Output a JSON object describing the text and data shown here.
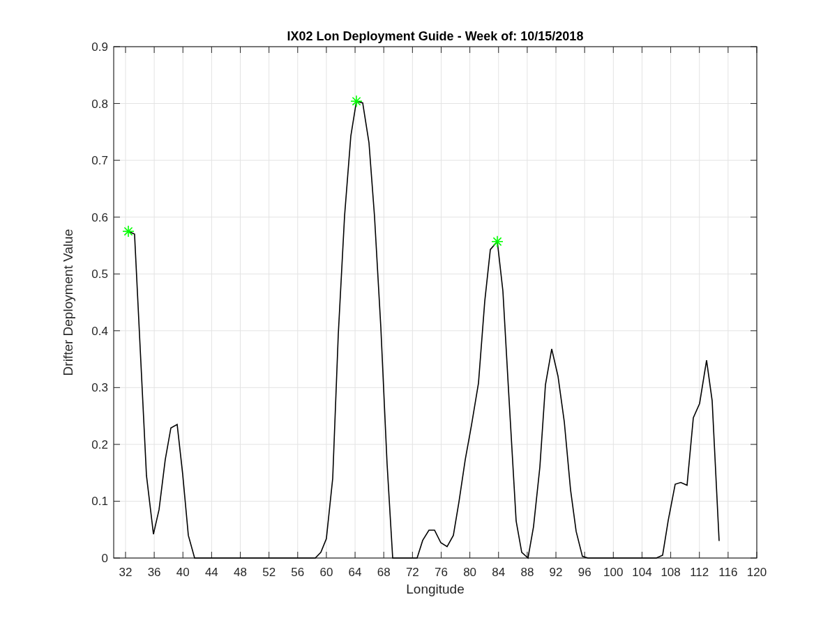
{
  "figure": {
    "chart_data": {
      "type": "line",
      "title": "IX02 Lon Deployment Guide - Week of: 10/15/2018",
      "xlabel": "Longitude",
      "ylabel": "Drifter Deployment Value",
      "x": [
        32.39,
        33.26,
        34.92,
        35.89,
        36.67,
        37.54,
        38.32,
        39.2,
        39.97,
        40.75,
        41.63,
        58.45,
        59.23,
        60.0,
        60.88,
        61.66,
        62.53,
        63.41,
        64.19,
        65.06,
        65.94,
        66.71,
        67.59,
        68.46,
        69.24,
        72.65,
        73.42,
        74.3,
        75.08,
        75.95,
        76.83,
        77.7,
        78.48,
        79.36,
        80.23,
        81.2,
        82.08,
        82.86,
        83.83,
        84.61,
        85.39,
        86.45,
        87.23,
        88.11,
        88.88,
        89.76,
        90.54,
        91.41,
        92.29,
        93.16,
        94.04,
        94.82,
        95.69,
        96.47,
        106.0,
        106.87,
        107.65,
        108.62,
        109.4,
        110.28,
        111.15,
        112.03,
        113.0,
        113.78,
        114.75
      ],
      "series": [
        {
          "color": "#000000",
          "marker": "none",
          "values": [
            0.575,
            0.57,
            0.145,
            0.042,
            0.085,
            0.173,
            0.229,
            0.235,
            0.148,
            0.04,
            0,
            0,
            0.01,
            0.034,
            0.14,
            0.394,
            0.602,
            0.743,
            0.804,
            0.801,
            0.731,
            0.602,
            0.406,
            0.167,
            0,
            0,
            0.031,
            0.049,
            0.049,
            0.027,
            0.02,
            0.04,
            0.099,
            0.173,
            0.234,
            0.308,
            0.452,
            0.543,
            0.557,
            0.47,
            0.295,
            0.065,
            0.01,
            0,
            0.055,
            0.16,
            0.305,
            0.368,
            0.32,
            0.24,
            0.12,
            0.047,
            0.003,
            0,
            0,
            0.005,
            0.066,
            0.13,
            0.133,
            0.128,
            0.247,
            0.272,
            0.348,
            0.277,
            0.03
          ]
        },
        {
          "color": "#00ff00",
          "marker": "cross",
          "values": [
            0.575,
            null,
            null,
            null,
            null,
            null,
            null,
            null,
            null,
            null,
            null,
            null,
            null,
            null,
            null,
            null,
            null,
            null,
            0.804,
            null,
            null,
            null,
            null,
            null,
            null,
            null,
            null,
            null,
            null,
            null,
            null,
            null,
            null,
            null,
            null,
            null,
            null,
            null,
            0.557,
            null,
            null,
            null,
            null,
            null,
            null,
            null,
            null,
            null,
            null,
            null,
            null,
            null,
            null,
            null,
            null,
            null,
            null,
            null,
            null,
            null,
            null,
            null,
            null,
            null,
            null
          ]
        }
      ],
      "grid": true,
      "xlim": [
        30.35,
        120
      ],
      "ylim": [
        0,
        0.9
      ],
      "xticks": [
        32,
        36,
        40,
        44,
        48,
        52,
        56,
        60,
        64,
        68,
        72,
        76,
        80,
        84,
        88,
        92,
        96,
        100,
        104,
        108,
        112,
        116,
        120
      ],
      "yticks": [
        0,
        0.1,
        0.2,
        0.3,
        0.4,
        0.5,
        0.6,
        0.7,
        0.8,
        0.9
      ]
    }
  }
}
